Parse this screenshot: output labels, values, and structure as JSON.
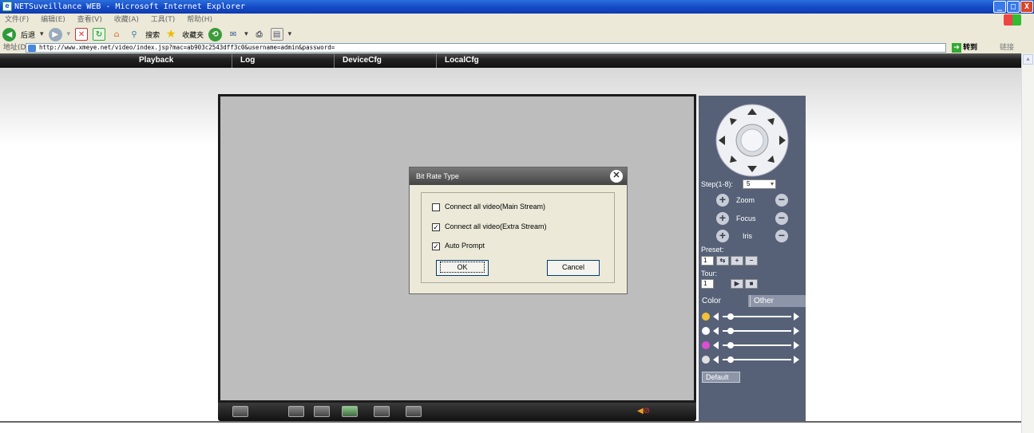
{
  "window": {
    "title": "NETSuveillance WEB - Microsoft Internet Explorer",
    "min": "_",
    "max": "□",
    "close": "X"
  },
  "menubar": {
    "items": [
      "文件(F)",
      "编辑(E)",
      "查看(V)",
      "收藏(A)",
      "工具(T)",
      "帮助(H)"
    ]
  },
  "toolbar": {
    "back": "后退",
    "search": "搜索",
    "favorites": "收藏夹"
  },
  "address": {
    "label": "地址(D)",
    "url": "http://www.xmeye.net/video/index.jsp?mac=ab903c2543dff3c0&username=admin&password=",
    "go": "转到",
    "links": "链接"
  },
  "nav": {
    "tabs": [
      "Playback",
      "Log",
      "DeviceCfg",
      "LocalCfg"
    ]
  },
  "dialog": {
    "title": "Bit Rate Type",
    "options": [
      {
        "label": "Connect all video(Main Stream)",
        "checked": false
      },
      {
        "label": "Connect all video(Extra Stream)",
        "checked": true
      },
      {
        "label": "Auto Prompt",
        "checked": true
      }
    ],
    "ok": "OK",
    "cancel": "Cancel"
  },
  "panel": {
    "step_label": "Step(1-8):",
    "step_value": "5",
    "zoom": "Zoom",
    "focus": "Focus",
    "iris": "Iris",
    "preset_label": "Preset:",
    "preset_value": "1",
    "tour_label": "Tour:",
    "tour_value": "1",
    "tabs": [
      "Color",
      "Other"
    ],
    "default": "Default",
    "sliders": [
      {
        "name": "brightness-icon",
        "color": "#f3c13a",
        "value": 0.12
      },
      {
        "name": "contrast-icon",
        "color": "#ffffff",
        "value": 0.12
      },
      {
        "name": "saturation-icon",
        "color": "#d94fd0",
        "value": 0.12
      },
      {
        "name": "hue-icon",
        "color": "#e0e0e0",
        "value": 0.12
      }
    ]
  },
  "colors": {
    "nav_bg": "#222222",
    "panel_bg": "#566178",
    "video_bg": "#bdbdbd",
    "ie_blue": "#1449c5"
  }
}
